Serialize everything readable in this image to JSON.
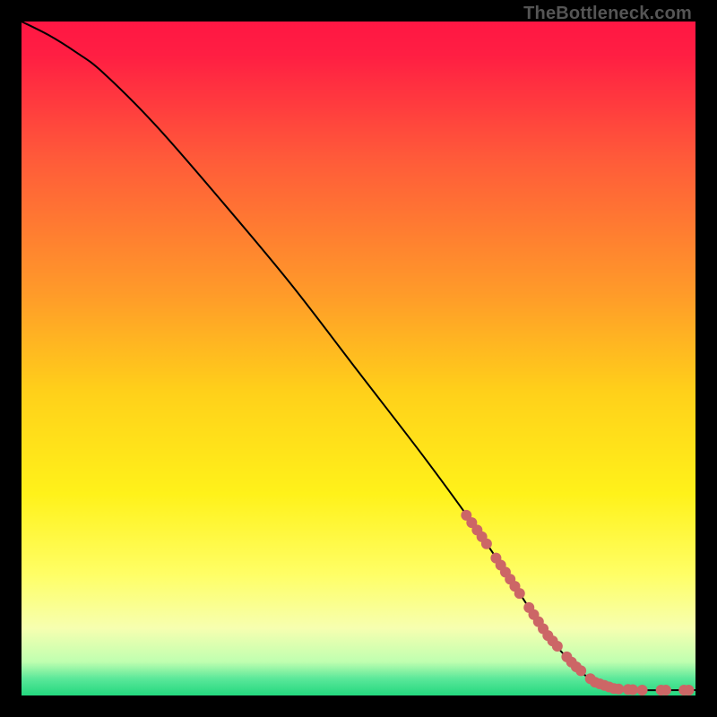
{
  "watermark": "TheBottleneck.com",
  "chart_data": {
    "type": "line",
    "title": "",
    "xlabel": "",
    "ylabel": "",
    "xlim": [
      0,
      100
    ],
    "ylim": [
      0,
      100
    ],
    "gradient_stops": [
      {
        "pos": 0.0,
        "color": "#ff1744"
      },
      {
        "pos": 0.05,
        "color": "#ff1f43"
      },
      {
        "pos": 0.2,
        "color": "#ff5a3a"
      },
      {
        "pos": 0.4,
        "color": "#ff9a2a"
      },
      {
        "pos": 0.55,
        "color": "#ffd11a"
      },
      {
        "pos": 0.7,
        "color": "#fff21a"
      },
      {
        "pos": 0.82,
        "color": "#ffff66"
      },
      {
        "pos": 0.9,
        "color": "#f7ffb0"
      },
      {
        "pos": 0.95,
        "color": "#c0ffb0"
      },
      {
        "pos": 0.975,
        "color": "#5be89a"
      },
      {
        "pos": 1.0,
        "color": "#24d87f"
      }
    ],
    "series": [
      {
        "name": "curve",
        "stroke": "#000000",
        "points": [
          {
            "x": 0,
            "y": 100
          },
          {
            "x": 4,
            "y": 98
          },
          {
            "x": 8,
            "y": 95.5
          },
          {
            "x": 12,
            "y": 92.5
          },
          {
            "x": 20,
            "y": 84.5
          },
          {
            "x": 30,
            "y": 73
          },
          {
            "x": 40,
            "y": 61
          },
          {
            "x": 50,
            "y": 48
          },
          {
            "x": 60,
            "y": 35
          },
          {
            "x": 68,
            "y": 24
          },
          {
            "x": 74,
            "y": 15
          },
          {
            "x": 78,
            "y": 9
          },
          {
            "x": 82,
            "y": 4.5
          },
          {
            "x": 85,
            "y": 2
          },
          {
            "x": 88,
            "y": 1
          },
          {
            "x": 92,
            "y": 0.8
          },
          {
            "x": 100,
            "y": 0.8
          }
        ]
      }
    ],
    "marker_xs": [
      66.0,
      66.8,
      67.6,
      68.3,
      69.0,
      70.4,
      71.1,
      71.8,
      72.5,
      73.2,
      73.9,
      75.3,
      76.0,
      76.7,
      77.4,
      78.1,
      78.8,
      79.5,
      80.9,
      81.6,
      82.3,
      83.0,
      84.4,
      85.1,
      85.8,
      86.5,
      87.2,
      87.9,
      88.6,
      90.0,
      90.7,
      92.1,
      94.9,
      95.6,
      98.3,
      99.0
    ],
    "marker_color": "#cc6666",
    "marker_radius_px": 6
  }
}
